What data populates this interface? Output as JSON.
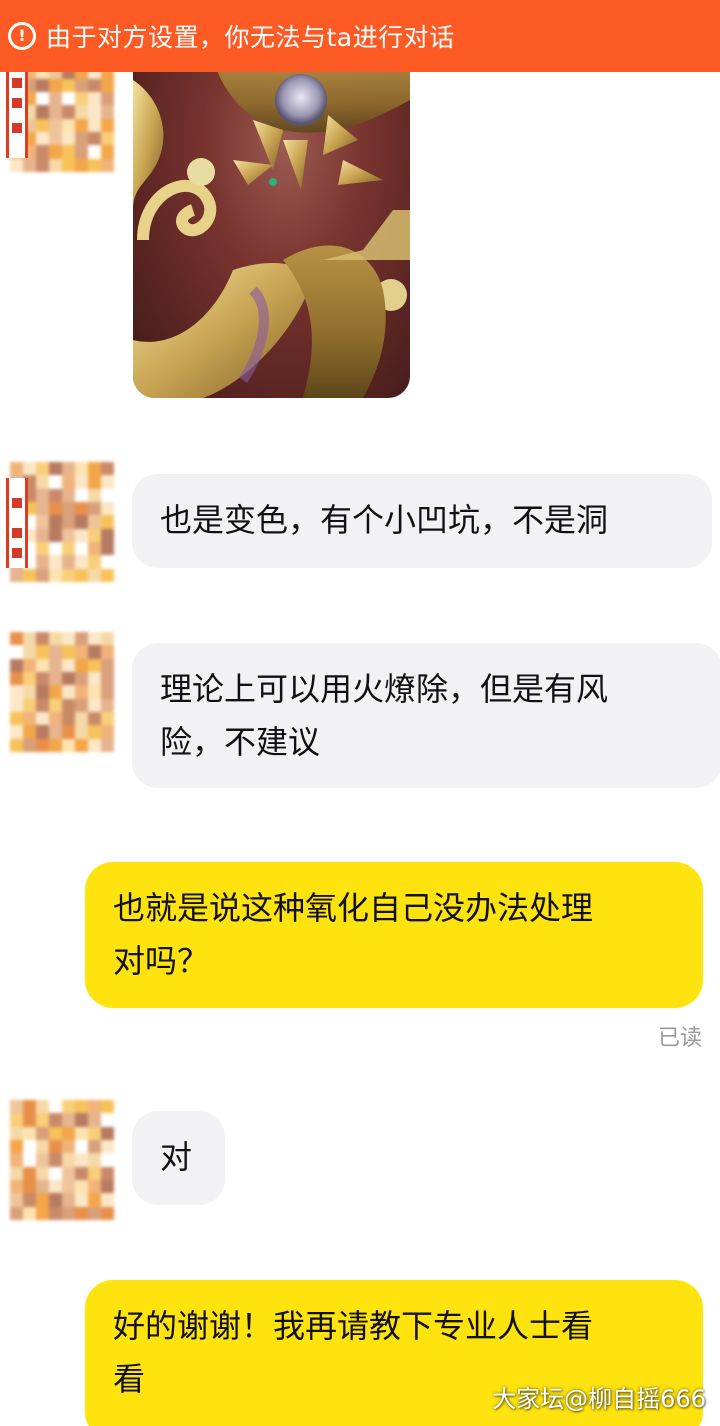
{
  "banner": {
    "icon": "exclamation-circle-icon",
    "glyph": "!",
    "text": "由于对方设置，你无法与ta进行对话"
  },
  "messages": [
    {
      "from": "other",
      "type": "image"
    },
    {
      "from": "other",
      "type": "text",
      "lines": [
        "也是变色，有个小凹坑，不是洞"
      ]
    },
    {
      "from": "other",
      "type": "text",
      "lines": [
        "理论上可以用火燎除，但是有风",
        "险，不建议"
      ]
    },
    {
      "from": "me",
      "type": "text",
      "lines": [
        "也就是说这种氧化自己没办法处理",
        "对吗？"
      ],
      "status": "已读"
    },
    {
      "from": "other",
      "type": "text",
      "lines": [
        "对"
      ]
    },
    {
      "from": "me",
      "type": "text",
      "lines": [
        "好的谢谢！我再请教下专业人士看",
        "看"
      ]
    }
  ],
  "watermark": "大家坛@柳自摇666",
  "colors": {
    "banner": "#fd5a24",
    "incoming_bubble": "#f2f2f4",
    "outgoing_bubble": "#ffe30f",
    "read_status": "#9a9a9a"
  }
}
